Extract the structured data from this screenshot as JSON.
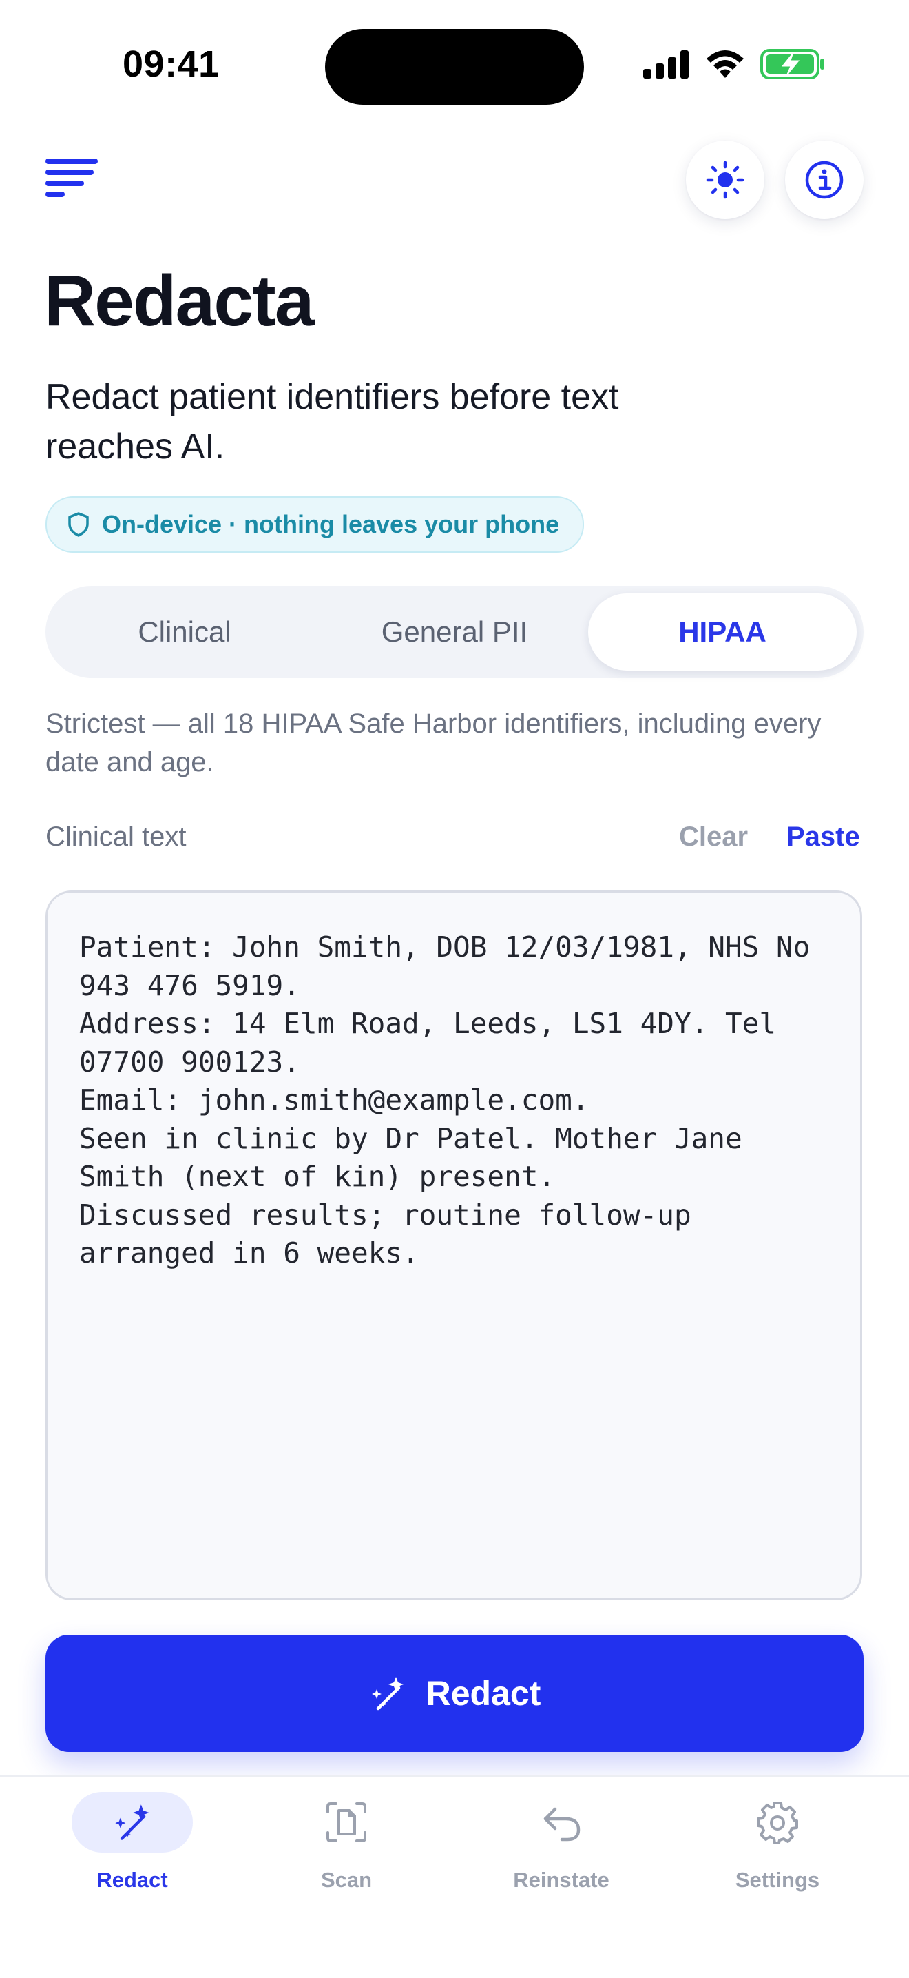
{
  "status_bar": {
    "time": "09:41"
  },
  "header": {
    "menu_icon": "menu-icon",
    "theme_icon": "sun-icon",
    "info_icon": "info-icon"
  },
  "app": {
    "title": "Redacta",
    "subtitle": "Redact patient identifiers before text reaches AI.",
    "badge": "On-device · nothing leaves your phone"
  },
  "modes": {
    "options": [
      "Clinical",
      "General PII",
      "HIPAA"
    ],
    "selected": "HIPAA",
    "description": "Strictest — all 18 HIPAA Safe Harbor identifiers, including every date and age."
  },
  "input": {
    "label": "Clinical text",
    "clear_label": "Clear",
    "paste_label": "Paste",
    "value": "Patient: John Smith, DOB 12/03/1981, NHS No 943 476 5919.\nAddress: 14 Elm Road, Leeds, LS1 4DY. Tel 07700 900123.\nEmail: john.smith@example.com.\nSeen in clinic by Dr Patel. Mother Jane Smith (next of kin) present.\nDiscussed results; routine follow-up arranged in 6 weeks."
  },
  "action": {
    "label": "Redact",
    "icon": "magic-wand-icon"
  },
  "tabbar": {
    "items": [
      {
        "label": "Redact",
        "icon": "magic-wand-icon",
        "active": true
      },
      {
        "label": "Scan",
        "icon": "scan-document-icon",
        "active": false
      },
      {
        "label": "Reinstate",
        "icon": "undo-arrow-icon",
        "active": false
      },
      {
        "label": "Settings",
        "icon": "gear-icon",
        "active": false
      }
    ]
  },
  "colors": {
    "accent": "#2231ee",
    "badge_text": "#1a8ba6",
    "battery": "#34c759"
  }
}
